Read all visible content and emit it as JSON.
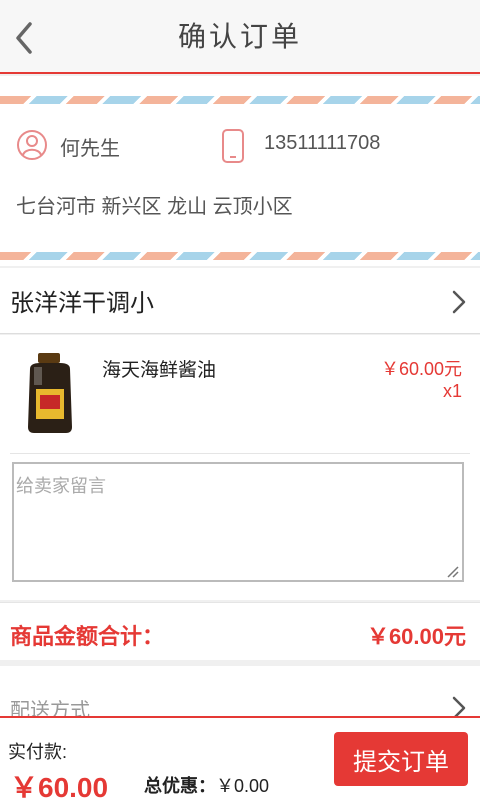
{
  "header": {
    "title": "确认订单",
    "back_icon": "chevron-left-icon"
  },
  "address": {
    "name": "何先生",
    "phone": "13511111708",
    "address": "七台河市 新兴区 龙山 云顶小区",
    "stripe_colors": [
      "#f4b49a",
      "#a7d4ea"
    ]
  },
  "shop": {
    "name": "张洋洋干调小"
  },
  "product": {
    "name": "海天海鲜酱油",
    "price": "￥60.00元",
    "quantity": "x1",
    "message_placeholder": "给卖家留言"
  },
  "summary": {
    "label": "商品金额合计：",
    "value": "￥60.00元"
  },
  "delivery": {
    "label": "配送方式"
  },
  "footer": {
    "pay_label": "实付款:",
    "pay_amount": "￥60.00",
    "discount_label": "总优惠：",
    "discount_value": "￥0.00",
    "submit_label": "提交订单"
  },
  "colors": {
    "accent": "#e53935"
  }
}
